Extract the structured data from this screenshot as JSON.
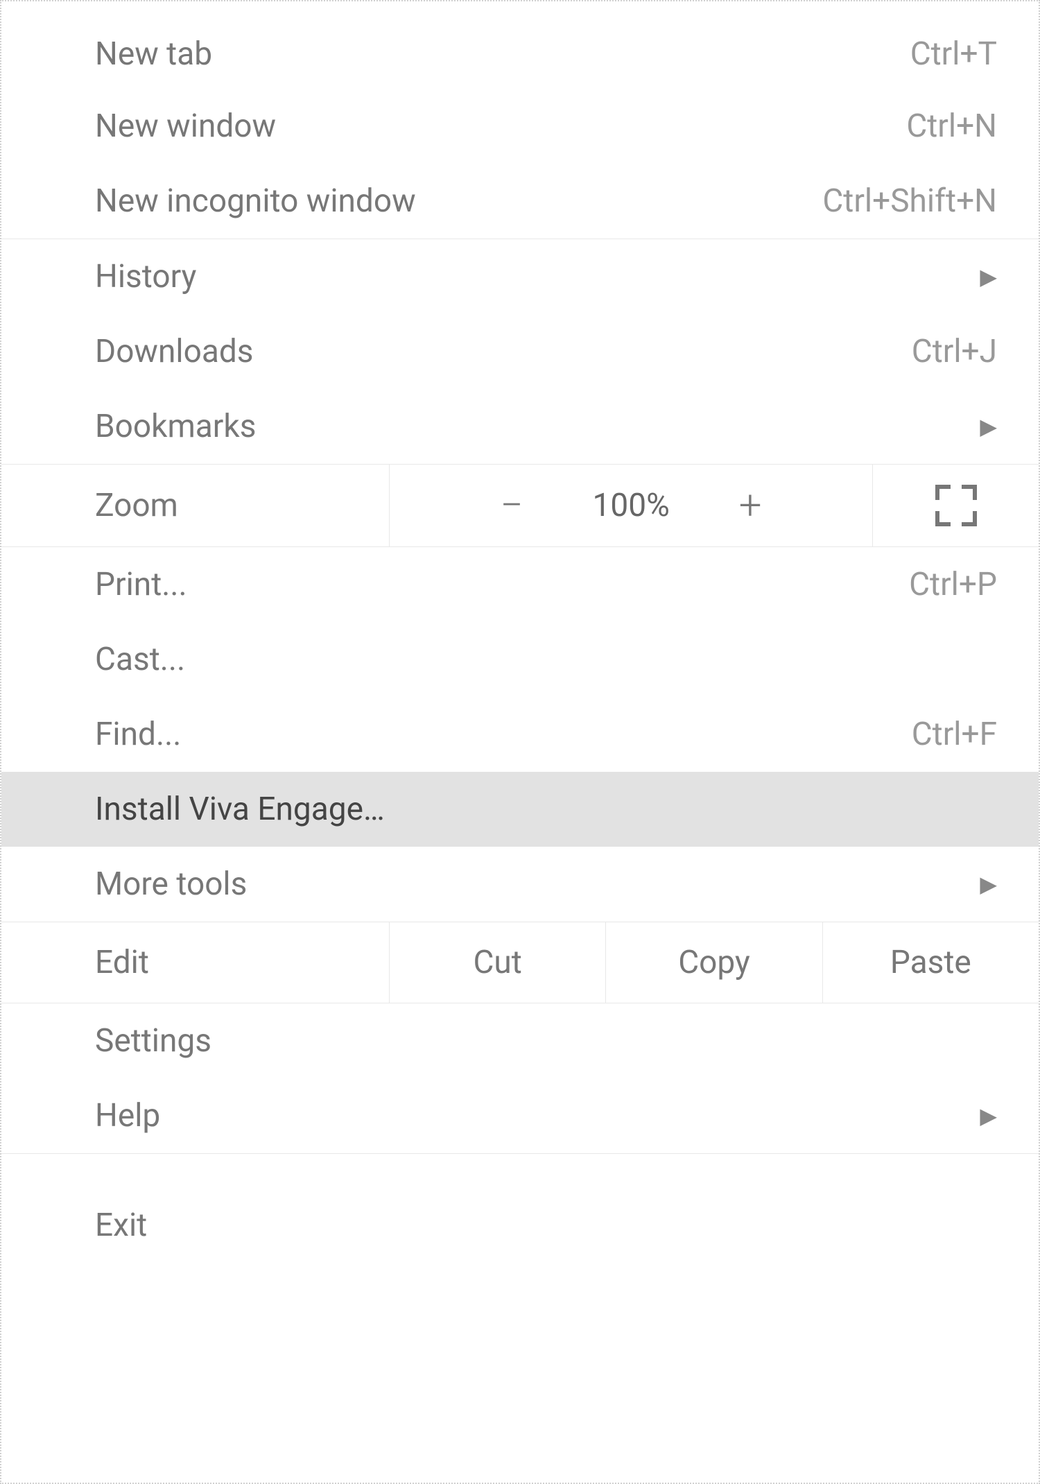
{
  "menu": {
    "section1": {
      "new_tab": {
        "label": "New tab",
        "shortcut": "Ctrl+T"
      },
      "new_window": {
        "label": "New window",
        "shortcut": "Ctrl+N"
      },
      "new_incognito": {
        "label": "New incognito window",
        "shortcut": "Ctrl+Shift+N"
      }
    },
    "section2": {
      "history": {
        "label": "History"
      },
      "downloads": {
        "label": "Downloads",
        "shortcut": "Ctrl+J"
      },
      "bookmarks": {
        "label": "Bookmarks"
      }
    },
    "section3": {
      "zoom": {
        "label": "Zoom",
        "minus": "−",
        "value": "100%",
        "plus": "+"
      }
    },
    "section4": {
      "print": {
        "label": "Print...",
        "shortcut": "Ctrl+P"
      },
      "cast": {
        "label": "Cast..."
      },
      "find": {
        "label": "Find...",
        "shortcut": "Ctrl+F"
      },
      "install": {
        "label": "Install Viva Engage…"
      },
      "more_tools": {
        "label": "More tools"
      }
    },
    "section5": {
      "edit": {
        "label": "Edit",
        "cut": "Cut",
        "copy": "Copy",
        "paste": "Paste"
      }
    },
    "section6": {
      "settings": {
        "label": "Settings"
      },
      "help": {
        "label": "Help"
      }
    },
    "section7": {
      "exit": {
        "label": "Exit"
      }
    }
  }
}
